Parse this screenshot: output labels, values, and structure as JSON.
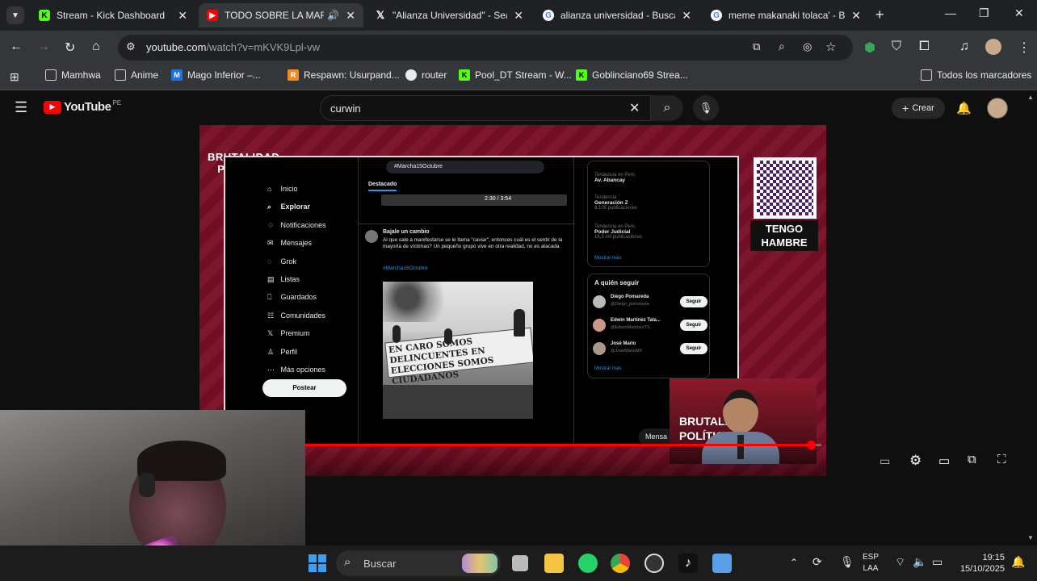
{
  "tabs": [
    {
      "title": "Stream - Kick Dashboard",
      "icon": "kick-icon",
      "active": false
    },
    {
      "title": "TODO SOBRE LA MARCH",
      "icon": "youtube-icon",
      "active": true
    },
    {
      "title": "\"Alianza Universidad\" - Sear",
      "icon": "x-icon",
      "active": false
    },
    {
      "title": "alianza universidad - Buscar",
      "icon": "google-icon",
      "active": false
    },
    {
      "title": "meme makanaki tolaca' - Bu",
      "icon": "google-icon",
      "active": false
    }
  ],
  "url": {
    "domain": "youtube.com",
    "path": "/watch?v=mKVK9Lpl-vw"
  },
  "bookmarks": [
    "Mamhwa",
    "Anime",
    "Mago Inferior –...",
    "Respawn: Usurpand...",
    "router",
    "Pool_DT Stream - W...",
    "Goblinciano69 Strea..."
  ],
  "all_bookmarks": "Todos los marcadores",
  "youtube": {
    "logo": "YouTube",
    "region": "PE",
    "search_value": "curwin",
    "create_label": "Crear"
  },
  "video": {
    "brand": [
      "BRUTALIDAD",
      "POLÍTICA"
    ],
    "qr_caption": [
      "TENGO",
      "HAMBRE"
    ],
    "nav": [
      "Inicio",
      "Explorar",
      "Notificaciones",
      "Mensajes",
      "Grok",
      "Listas",
      "Guardados",
      "Comunidades",
      "Premium",
      "Perfil",
      "Más opciones"
    ],
    "post_button": "Postear",
    "search": "#Marcha15Octubre",
    "tab_featured": "Destacado",
    "player_time": "2:30 / 3:54",
    "tweet_author": "Bajale un cambio",
    "tweet_text": "Al que sale a manifestarse se le llama \"caviar\", entonces cuál es el sentir de la mayoría de víctimas? Un pequeño grupo vive en otra realidad, no es atacada",
    "tweet_hashtag": "#Marcha15Octubre",
    "banner_text": "EN CARO SOMOS DELINCUENTES EN ELECCIONES SOMOS CIUDADANOS",
    "trends": [
      {
        "label": "Tendencia en Perú",
        "name": "Av. Abancay"
      },
      {
        "label": "Tendencia",
        "name": "Generación Z",
        "count": "8.105 publicaciones"
      },
      {
        "label": "Tendencia en Perú",
        "name": "Poder Judicial",
        "count": "16,3 mil publicaciones"
      }
    ],
    "show_more": "Mostrar más",
    "who_to_follow": "A quién seguir",
    "follow": [
      {
        "name": "Diego Pomareda",
        "handle": "@Diego_pomareda"
      },
      {
        "name": "Edwin Martinez Tala...",
        "handle": "@EdwinMartinezTS"
      },
      {
        "name": "José Mario",
        "handle": "@JoseMarioMX"
      }
    ],
    "follow_button": "Seguir",
    "messages": "Mensa",
    "cam_brand": "BRUTALIDAD POLÍTICA",
    "progress": 0.98
  },
  "taskbar": {
    "search": "Buscar",
    "lang": [
      "ESP",
      "LAA"
    ],
    "time": "19:15",
    "date": "15/10/2025"
  }
}
